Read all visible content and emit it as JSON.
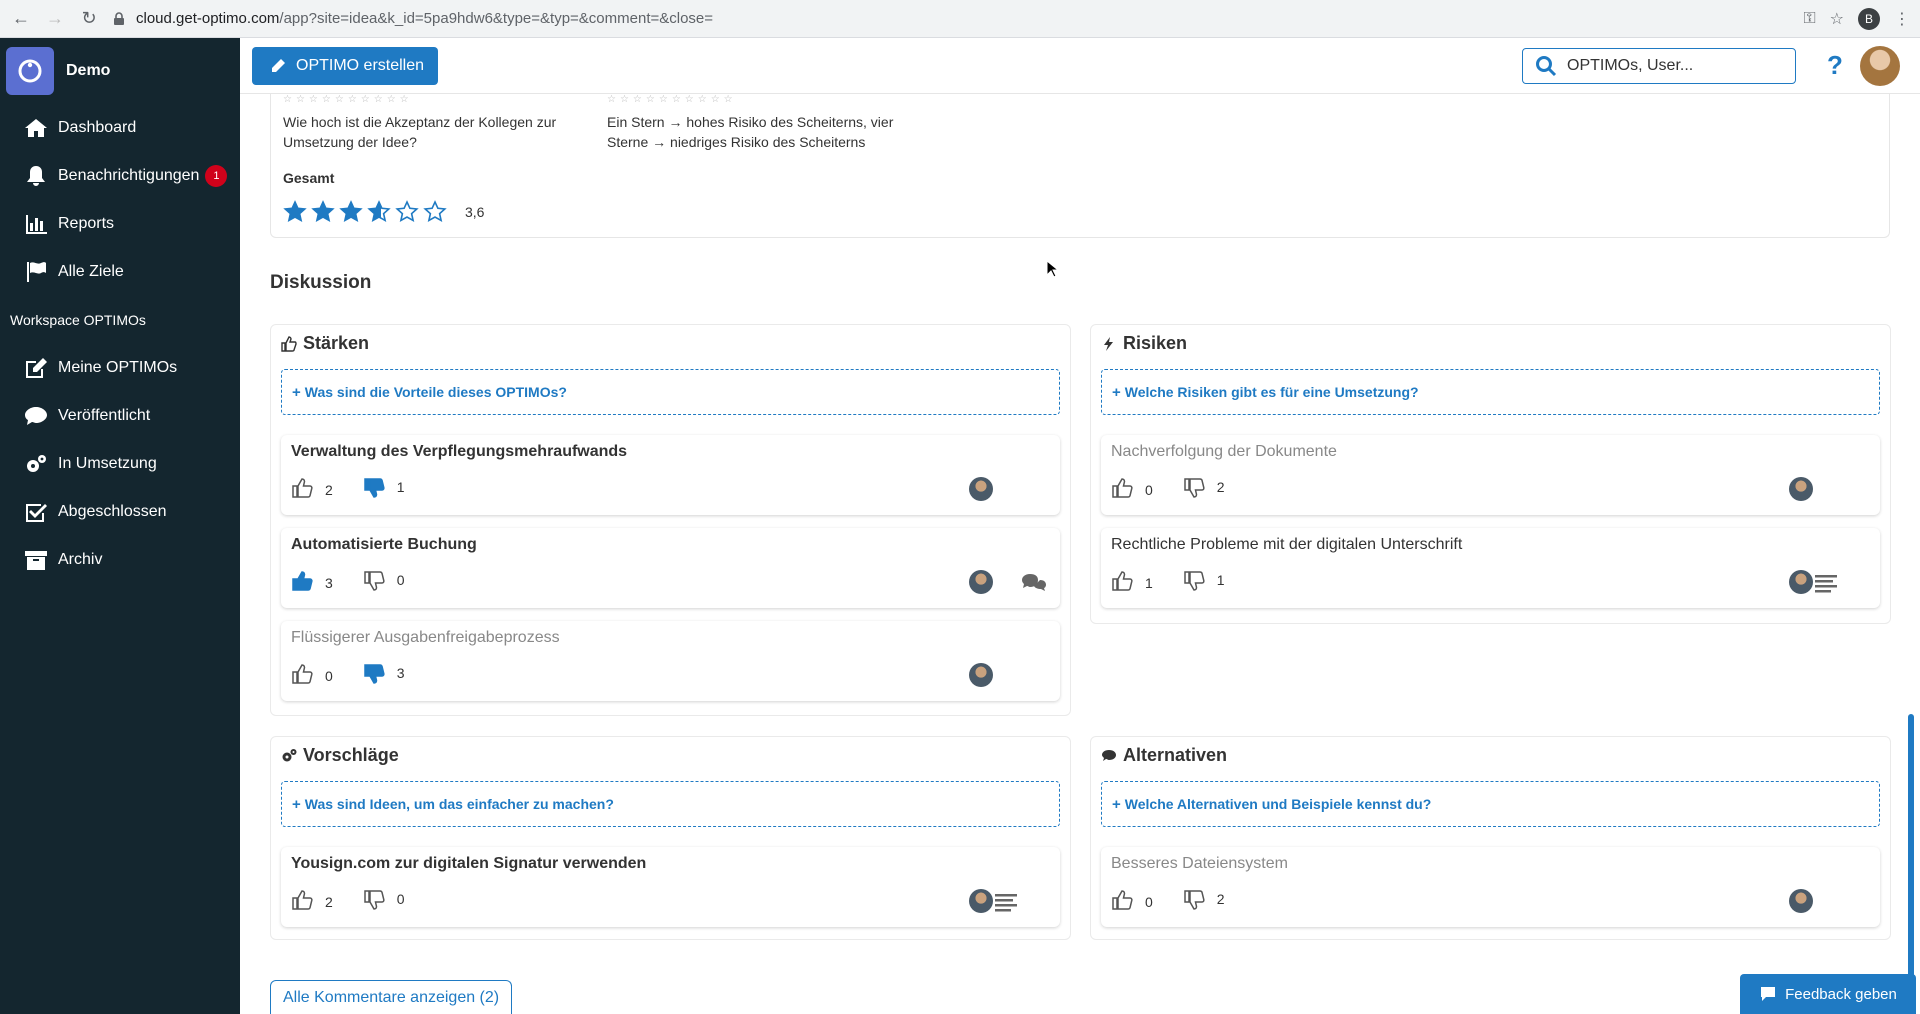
{
  "browser": {
    "url_host": "cloud.get-optimo.com",
    "url_path": "/app?site=idea&k_id=5pa9hdw6&type=&typ=&comment=&close=",
    "profile_initial": "B"
  },
  "sidebar": {
    "brand": "Demo",
    "items": [
      {
        "label": "Dashboard",
        "icon": "home-icon"
      },
      {
        "label": "Benachrichtigungen",
        "icon": "bell-icon",
        "badge": "1"
      },
      {
        "label": "Reports",
        "icon": "bar-chart-icon"
      },
      {
        "label": "Alle Ziele",
        "icon": "flag-icon"
      }
    ],
    "workspace_label": "Workspace OPTIMOs",
    "workspace_items": [
      {
        "label": "Meine OPTIMOs",
        "icon": "edit-icon"
      },
      {
        "label": "Veröffentlicht",
        "icon": "chat-icon"
      },
      {
        "label": "In Umsetzung",
        "icon": "gears-icon"
      },
      {
        "label": "Abgeschlossen",
        "icon": "checkbox-icon"
      },
      {
        "label": "Archiv",
        "icon": "archive-icon"
      }
    ]
  },
  "topbar": {
    "create_label": "OPTIMO erstellen",
    "search_placeholder": "OPTIMOs, User...",
    "help": "?"
  },
  "rating": {
    "q1": "Wie hoch ist die Akzeptanz der Kollegen zur Umsetzung der Idee?",
    "q2": "Ein Stern → hohes Risiko des Scheiterns, vier Sterne → niedriges Risiko des Scheiterns",
    "gesamt_label": "Gesamt",
    "score": "3,6",
    "score_value": 3.6,
    "max_stars": 6
  },
  "discussion": {
    "title": "Diskussion",
    "staerken": {
      "title": "Stärken",
      "prompt": "Was sind die Vorteile dieses OPTIMOs?",
      "items": [
        {
          "title": "Verwaltung des Verpflegungsmehraufwands",
          "up": "2",
          "down": "1"
        },
        {
          "title": "Automatisierte Buchung",
          "up": "3",
          "down": "0"
        },
        {
          "title": "Flüssigerer Ausgabenfreigabeprozess",
          "up": "0",
          "down": "3"
        }
      ]
    },
    "risiken": {
      "title": "Risiken",
      "prompt": "Welche Risiken gibt es für eine Umsetzung?",
      "items": [
        {
          "title": "Nachverfolgung der Dokumente",
          "up": "0",
          "down": "2"
        },
        {
          "title": "Rechtliche Probleme mit der digitalen Unterschrift",
          "up": "1",
          "down": "1"
        }
      ]
    },
    "vorschlaege": {
      "title": "Vorschläge",
      "prompt": "Was sind Ideen, um das einfacher zu machen?",
      "items": [
        {
          "title": "Yousign.com zur digitalen Signatur verwenden",
          "up": "2",
          "down": "0"
        }
      ]
    },
    "alternativen": {
      "title": "Alternativen",
      "prompt": "Welche Alternativen und Beispiele kennst du?",
      "items": [
        {
          "title": "Besseres Dateiensystem",
          "up": "0",
          "down": "2"
        }
      ]
    },
    "all_comments": "Alle Kommentare anzeigen (2)"
  },
  "feedback_label": "Feedback geben",
  "colors": {
    "accent": "#1f7ac3",
    "sidebar": "#14262f",
    "badge": "#d0021b"
  }
}
